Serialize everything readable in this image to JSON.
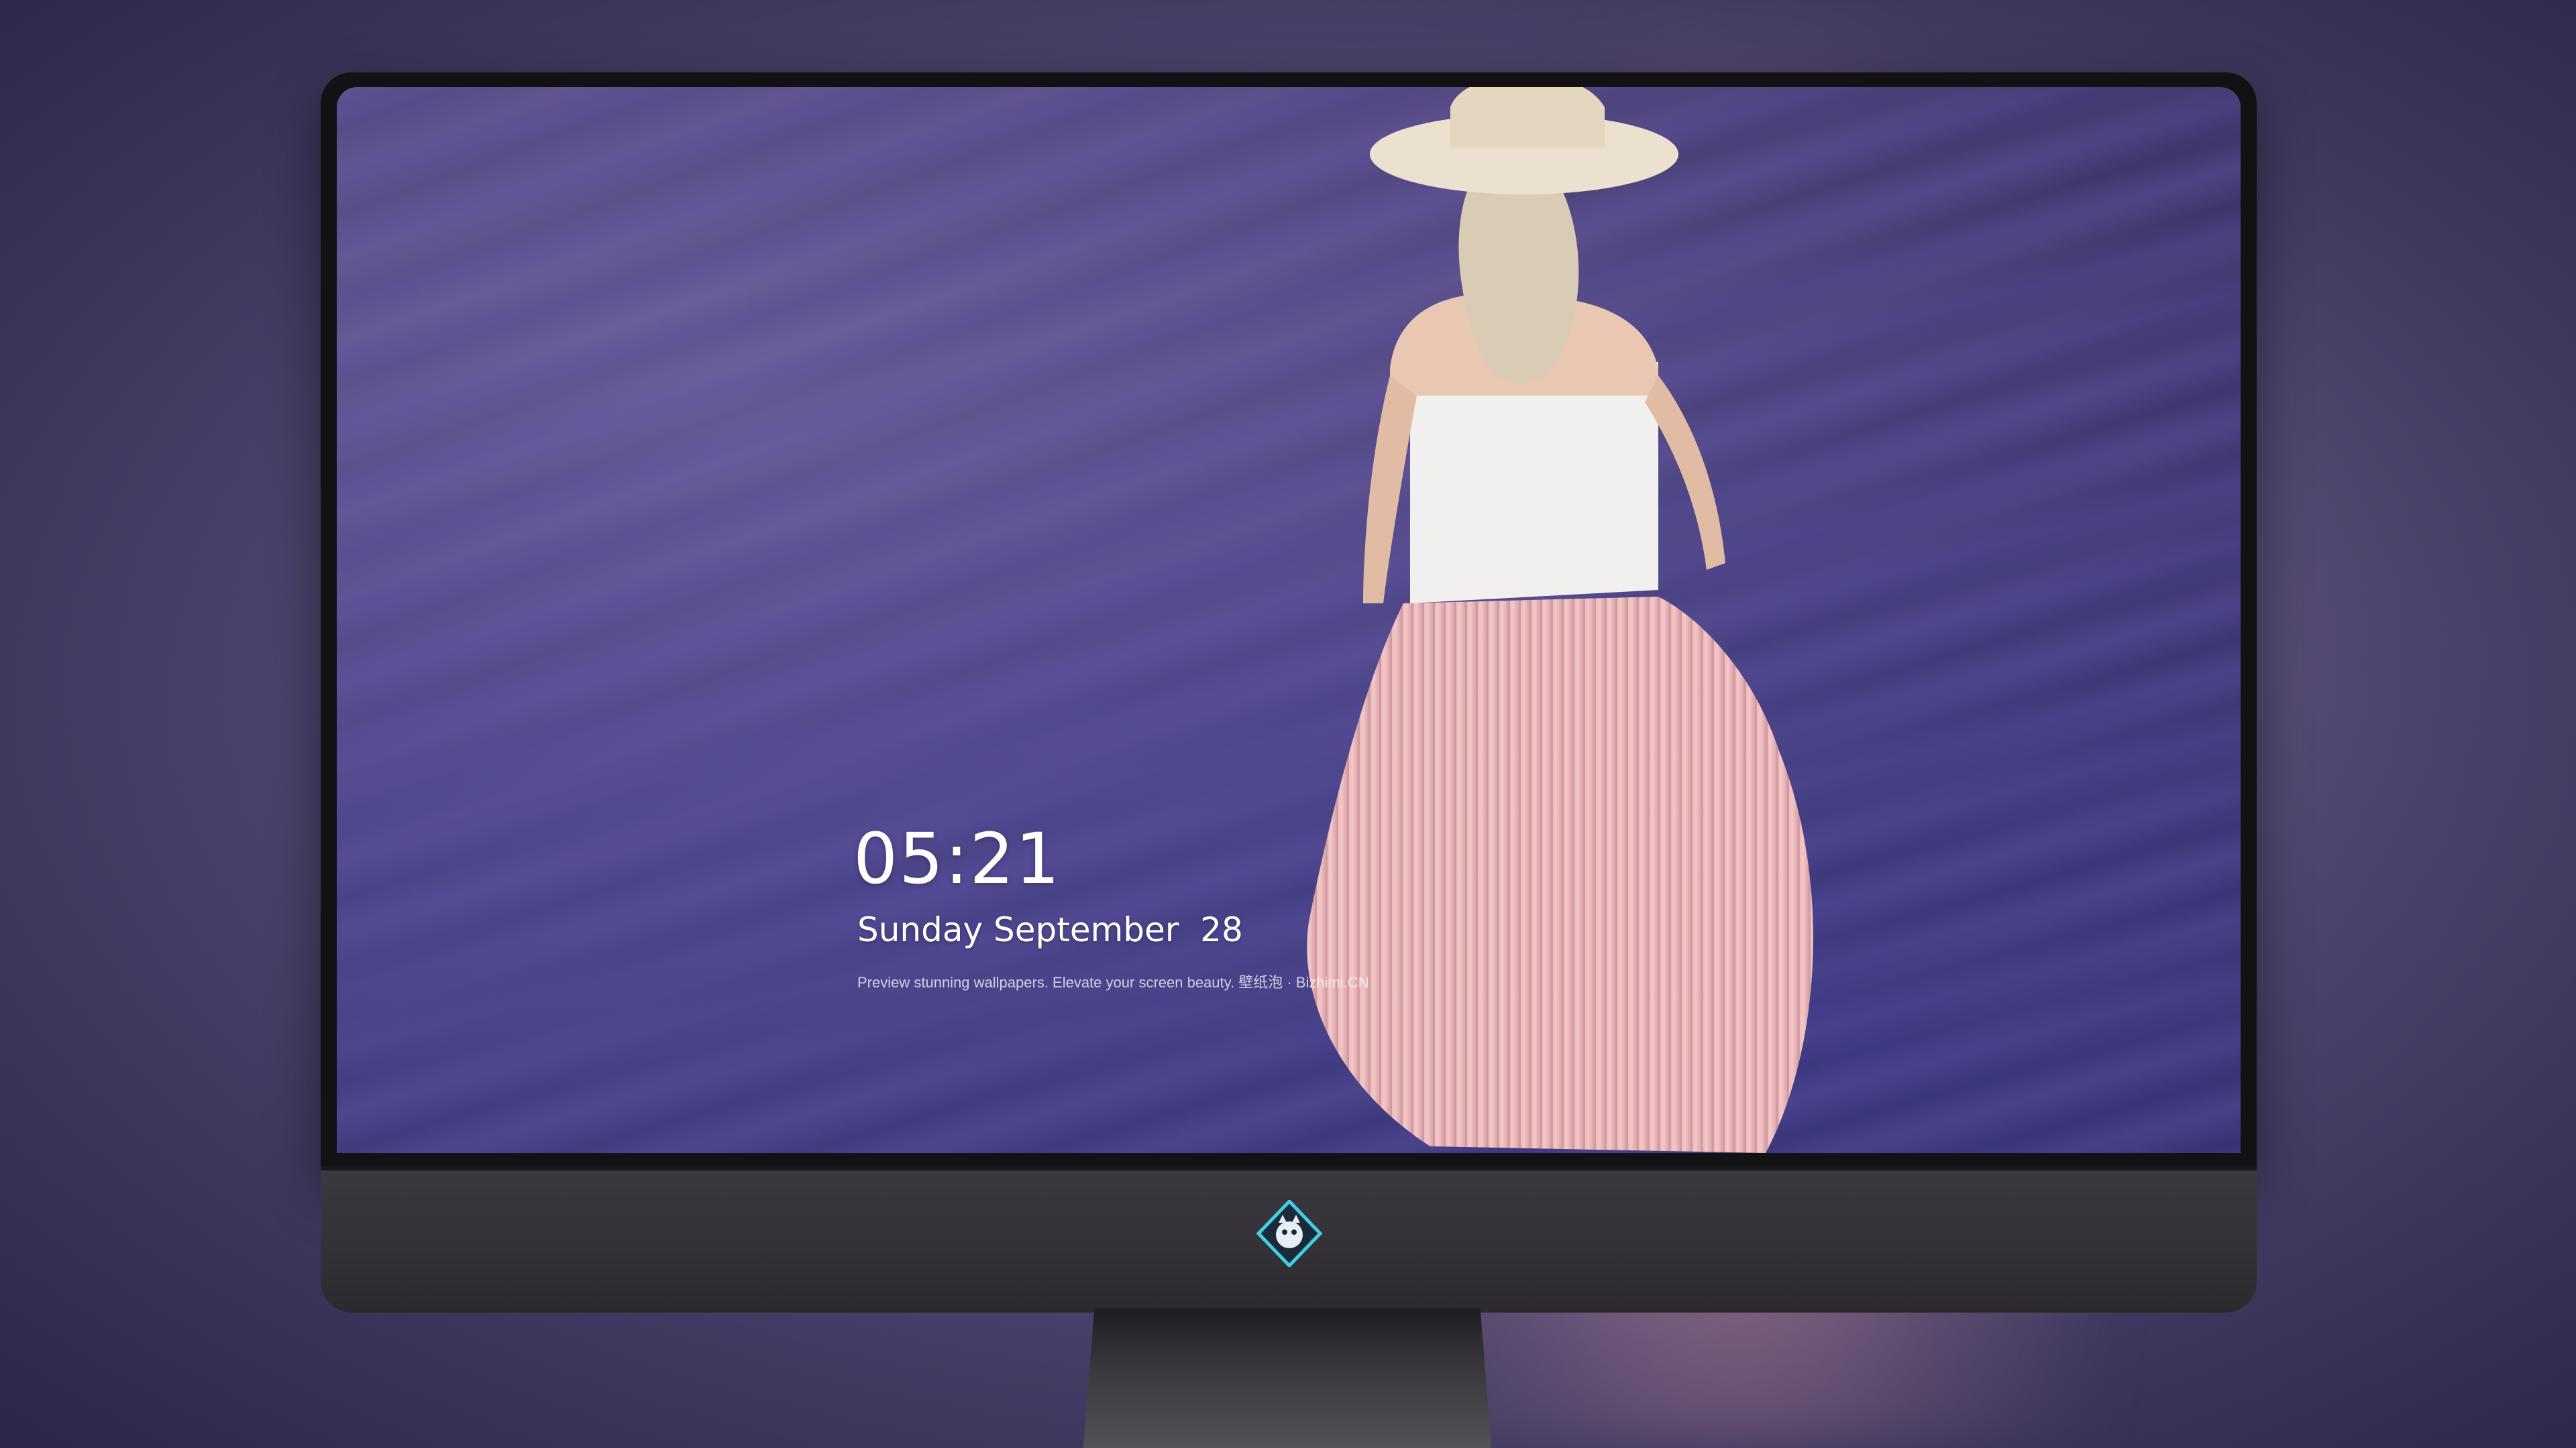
{
  "lock_screen": {
    "time": "05:21",
    "date": "Sunday September  28",
    "caption": "Preview stunning wallpapers. Elevate your screen beauty. 壁纸泡 · Bizhimi.CN"
  },
  "dock": {
    "apps": [
      {
        "name": "messages-icon",
        "color": "#34c759"
      },
      {
        "name": "weather-icon",
        "color": "#1e88e5"
      },
      {
        "name": "clock-icon",
        "color": "#111111"
      },
      {
        "name": "preview-icon",
        "color": "#f5c542"
      },
      {
        "name": "clips-icon",
        "color": "#2db7e8"
      },
      {
        "name": "notes-icon",
        "color": "#ffd54a"
      },
      {
        "name": "photo-booth-icon",
        "color": "#e85d5d"
      },
      {
        "name": "music-icon",
        "color": "#f94cbb"
      },
      {
        "name": "app-store-icon",
        "color": "#1a8cff"
      },
      {
        "name": "camera-icon",
        "color": "#3a3a3c"
      }
    ]
  },
  "colors": {
    "background": "#4e4670",
    "bezel": "#121214",
    "chin": "#333136"
  }
}
